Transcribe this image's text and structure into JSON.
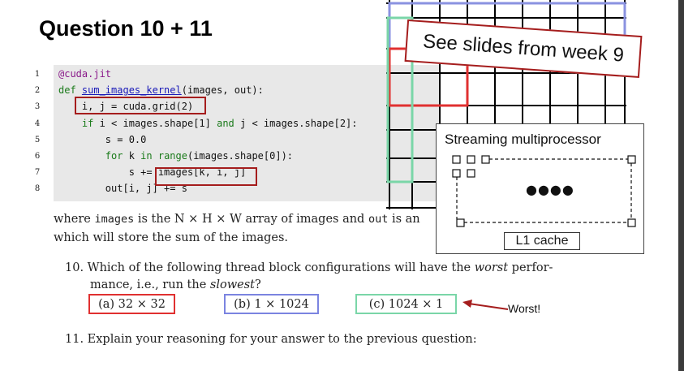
{
  "title": "Question 10 + 11",
  "code": {
    "line_numbers": [
      "1",
      "2",
      "3",
      "4",
      "5",
      "6",
      "7",
      "8"
    ],
    "lines": [
      {
        "indent": "",
        "parts": [
          {
            "t": "@cuda.jit",
            "c": "dec"
          }
        ]
      },
      {
        "indent": "",
        "parts": [
          {
            "t": "def ",
            "c": "kw"
          },
          {
            "t": "sum_images_kernel",
            "c": "fn"
          },
          {
            "t": "(images, out):",
            "c": ""
          }
        ]
      },
      {
        "indent": "    ",
        "parts": [
          {
            "t": "i, j = cuda.grid(2)",
            "c": ""
          }
        ]
      },
      {
        "indent": "    ",
        "parts": [
          {
            "t": "if ",
            "c": "kw"
          },
          {
            "t": "i < images.shape[1] ",
            "c": ""
          },
          {
            "t": "and",
            "c": "kw"
          },
          {
            "t": " j < images.shape[2]:",
            "c": ""
          }
        ]
      },
      {
        "indent": "        ",
        "parts": [
          {
            "t": "s = 0.0",
            "c": ""
          }
        ]
      },
      {
        "indent": "        ",
        "parts": [
          {
            "t": "for ",
            "c": "kw"
          },
          {
            "t": "k ",
            "c": ""
          },
          {
            "t": "in ",
            "c": "kw"
          },
          {
            "t": "range",
            "c": "kw"
          },
          {
            "t": "(images.shape[0]):",
            "c": ""
          }
        ]
      },
      {
        "indent": "            ",
        "parts": [
          {
            "t": "s += images[k, i, j]",
            "c": ""
          }
        ]
      },
      {
        "indent": "        ",
        "parts": [
          {
            "t": "out[i, j] += s",
            "c": ""
          }
        ]
      }
    ]
  },
  "slides_note": "See slides from week 9",
  "sm": {
    "title": "Streaming multiprocessor",
    "dots": "●●●●",
    "l1": "L1 cache"
  },
  "description": {
    "line1_a": "where ",
    "line1_code1": "images",
    "line1_b": " is the N × H × W array of images and ",
    "line1_code2": "out",
    "line1_c": " is an",
    "line2": "which will store the sum of the images."
  },
  "q10": {
    "line1_a": "10.  Which of the following thread block configurations will have the ",
    "line1_em1": "worst",
    "line1_b": " perfor-",
    "line2_a": "mance, i.e., run the ",
    "line2_em": "slowest",
    "line2_b": "?"
  },
  "options": [
    {
      "label": "(a) 32 × 32",
      "color": "#e03030"
    },
    {
      "label": "(b) 1 × 1024",
      "color": "#7b84e0"
    },
    {
      "label": "(c) 1024 × 1",
      "color": "#7ad6a8"
    }
  ],
  "worst_label": "Worst!",
  "q11": "11.  Explain your reasoning for your answer to the previous question:",
  "colors": {
    "accent_red": "#a51d1d",
    "grid": "#000000"
  }
}
